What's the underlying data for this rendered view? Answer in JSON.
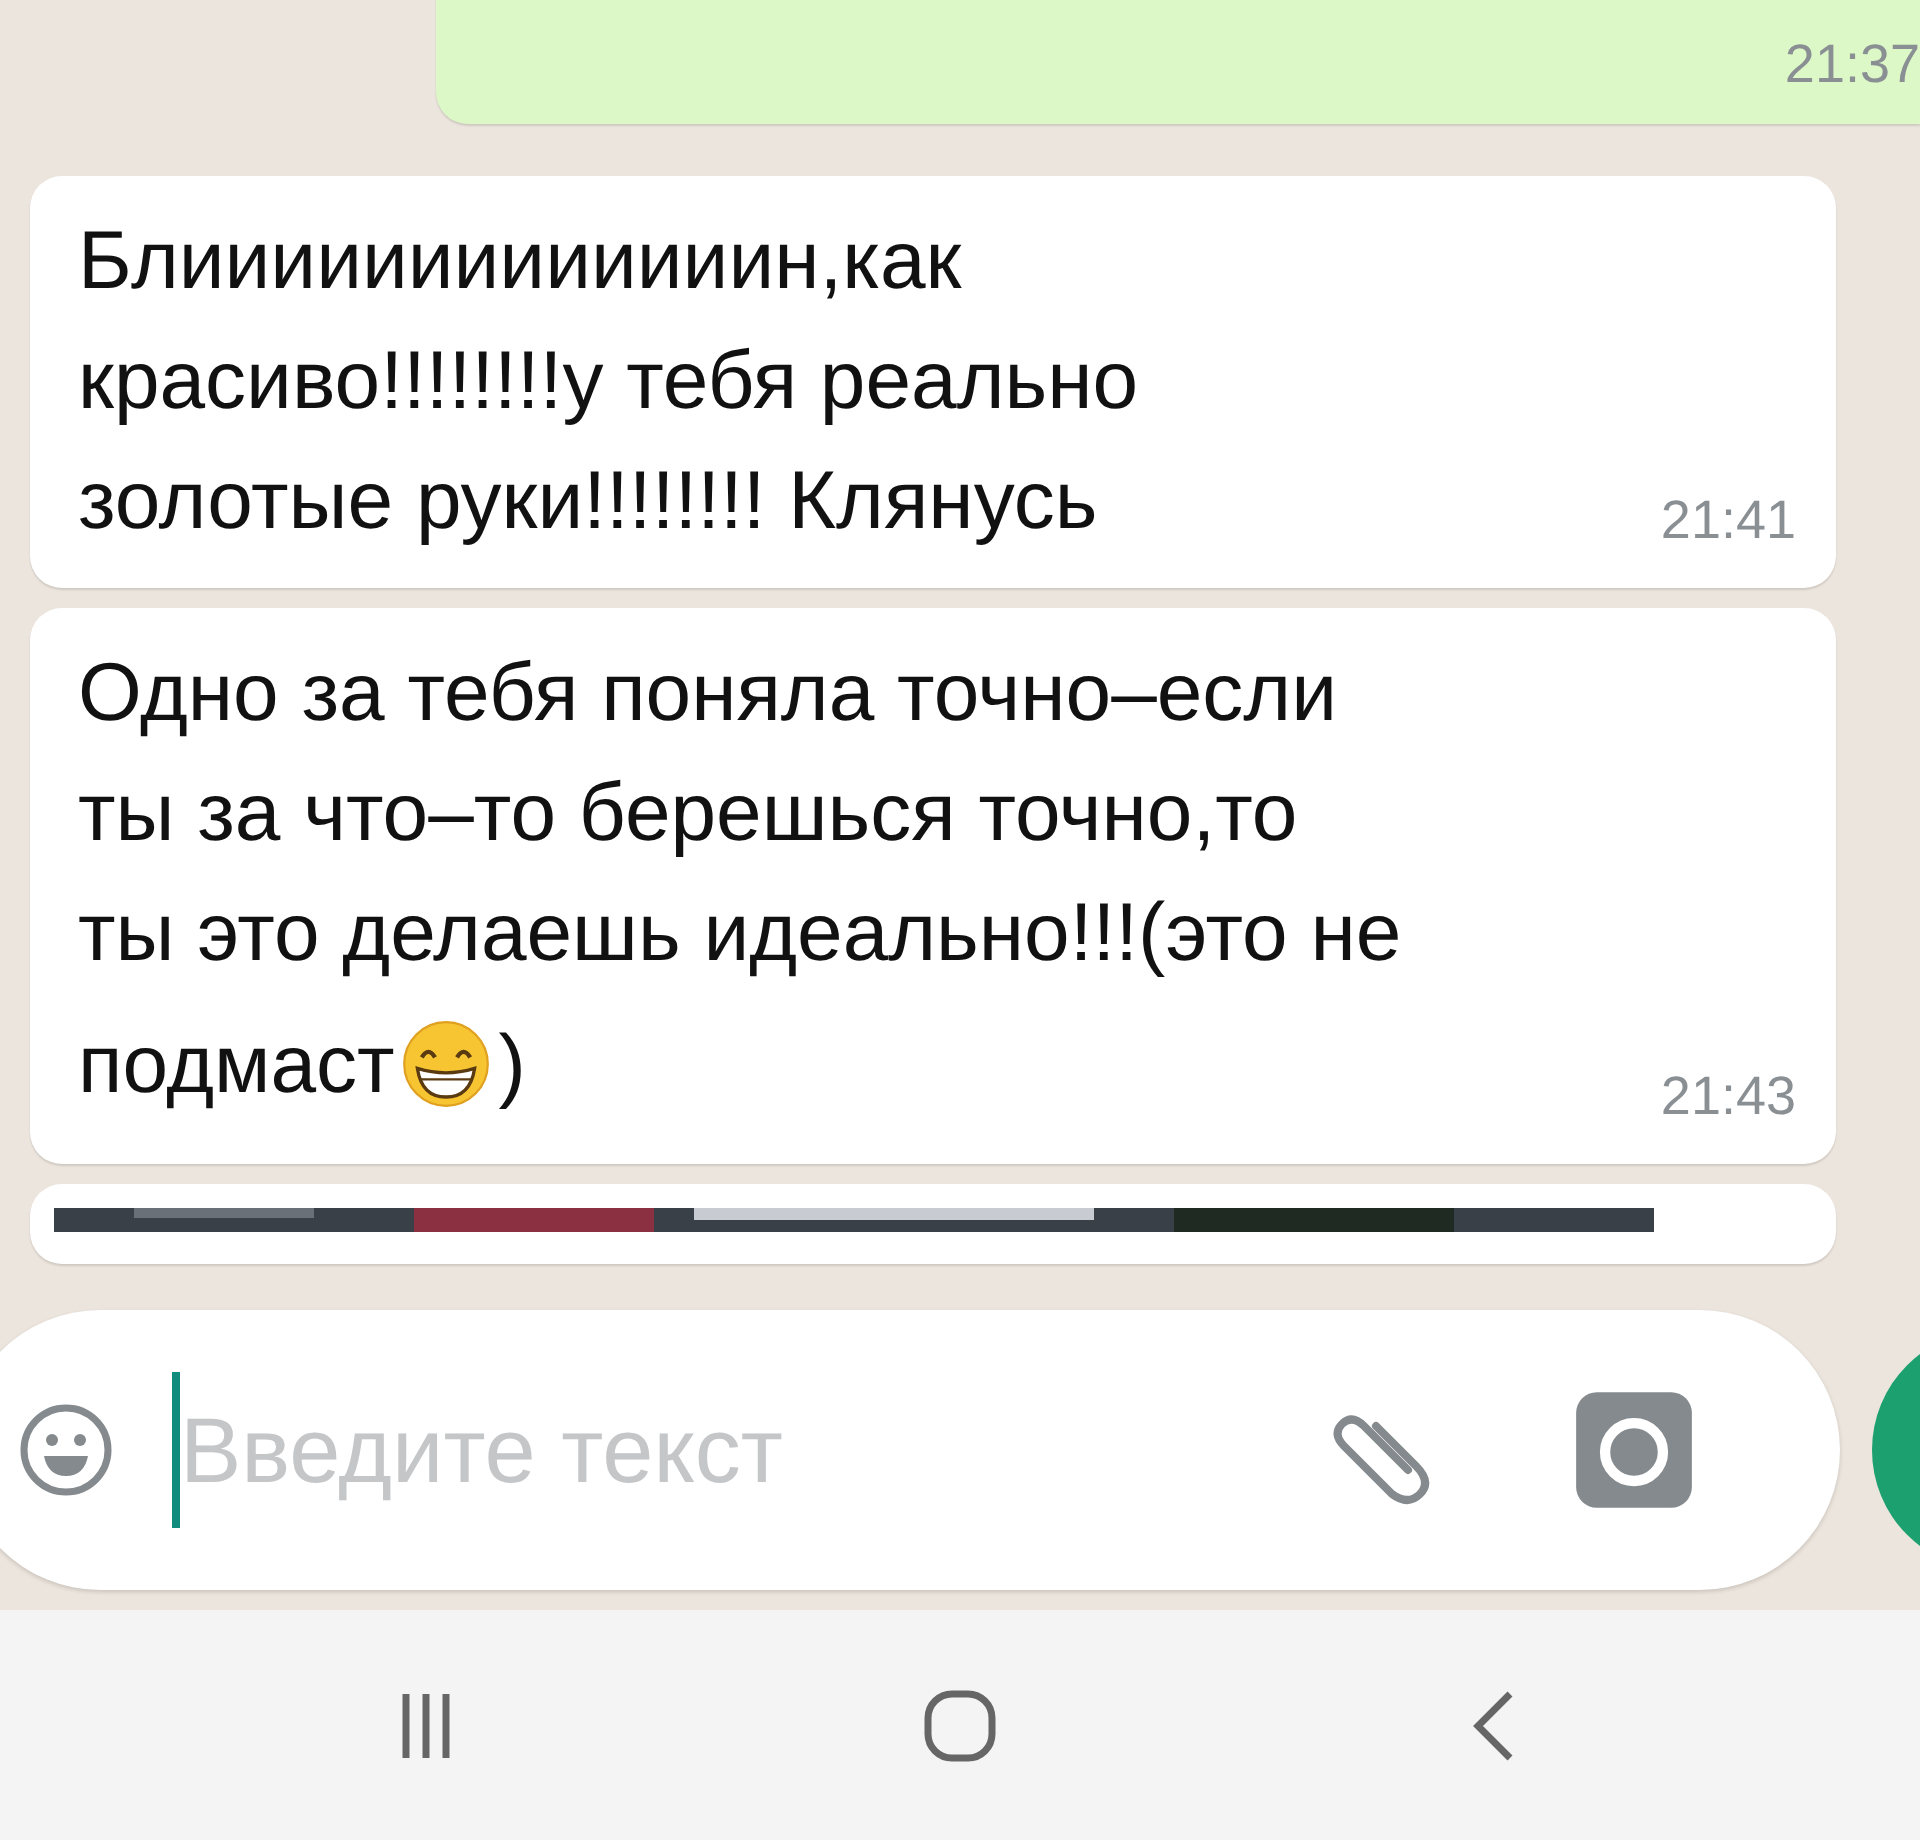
{
  "outgoing": {
    "time": "21:37"
  },
  "messages": [
    {
      "lines": [
        "Блииииииииииииин,как",
        "красиво!!!!!!!!у тебя реально",
        "золотые руки!!!!!!!! Клянусь"
      ],
      "time": "21:41"
    },
    {
      "lines": [
        "Одно за тебя поняла точно–если",
        "ты за что–то берешься точно,то",
        "ты это делаешь идеально!!!(это не",
        "подмаст"
      ],
      "after_emoji": ")",
      "time": "21:43"
    }
  ],
  "input": {
    "placeholder": "Введите текст"
  }
}
